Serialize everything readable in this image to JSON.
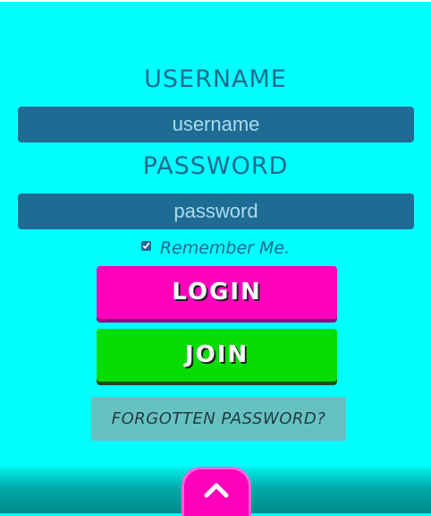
{
  "form": {
    "username_label": "USERNAME",
    "username_placeholder": "username",
    "password_label": "PASSWORD",
    "password_placeholder": "password",
    "remember_label": "Remember Me.",
    "remember_checked": true,
    "login_label": "LOGIN",
    "join_label": "JOIN",
    "forgot_label": "FORGOTTEN PASSWORD?"
  },
  "footer": {
    "scroll_up_icon": "chevron-up-icon"
  },
  "colors": {
    "background": "#00ffff",
    "field": "#1e6b94",
    "label_text": "#1a6b8e",
    "login_button": "#ff00bb",
    "join_button": "#05dd00",
    "forgot_background": "#66c2c0"
  }
}
